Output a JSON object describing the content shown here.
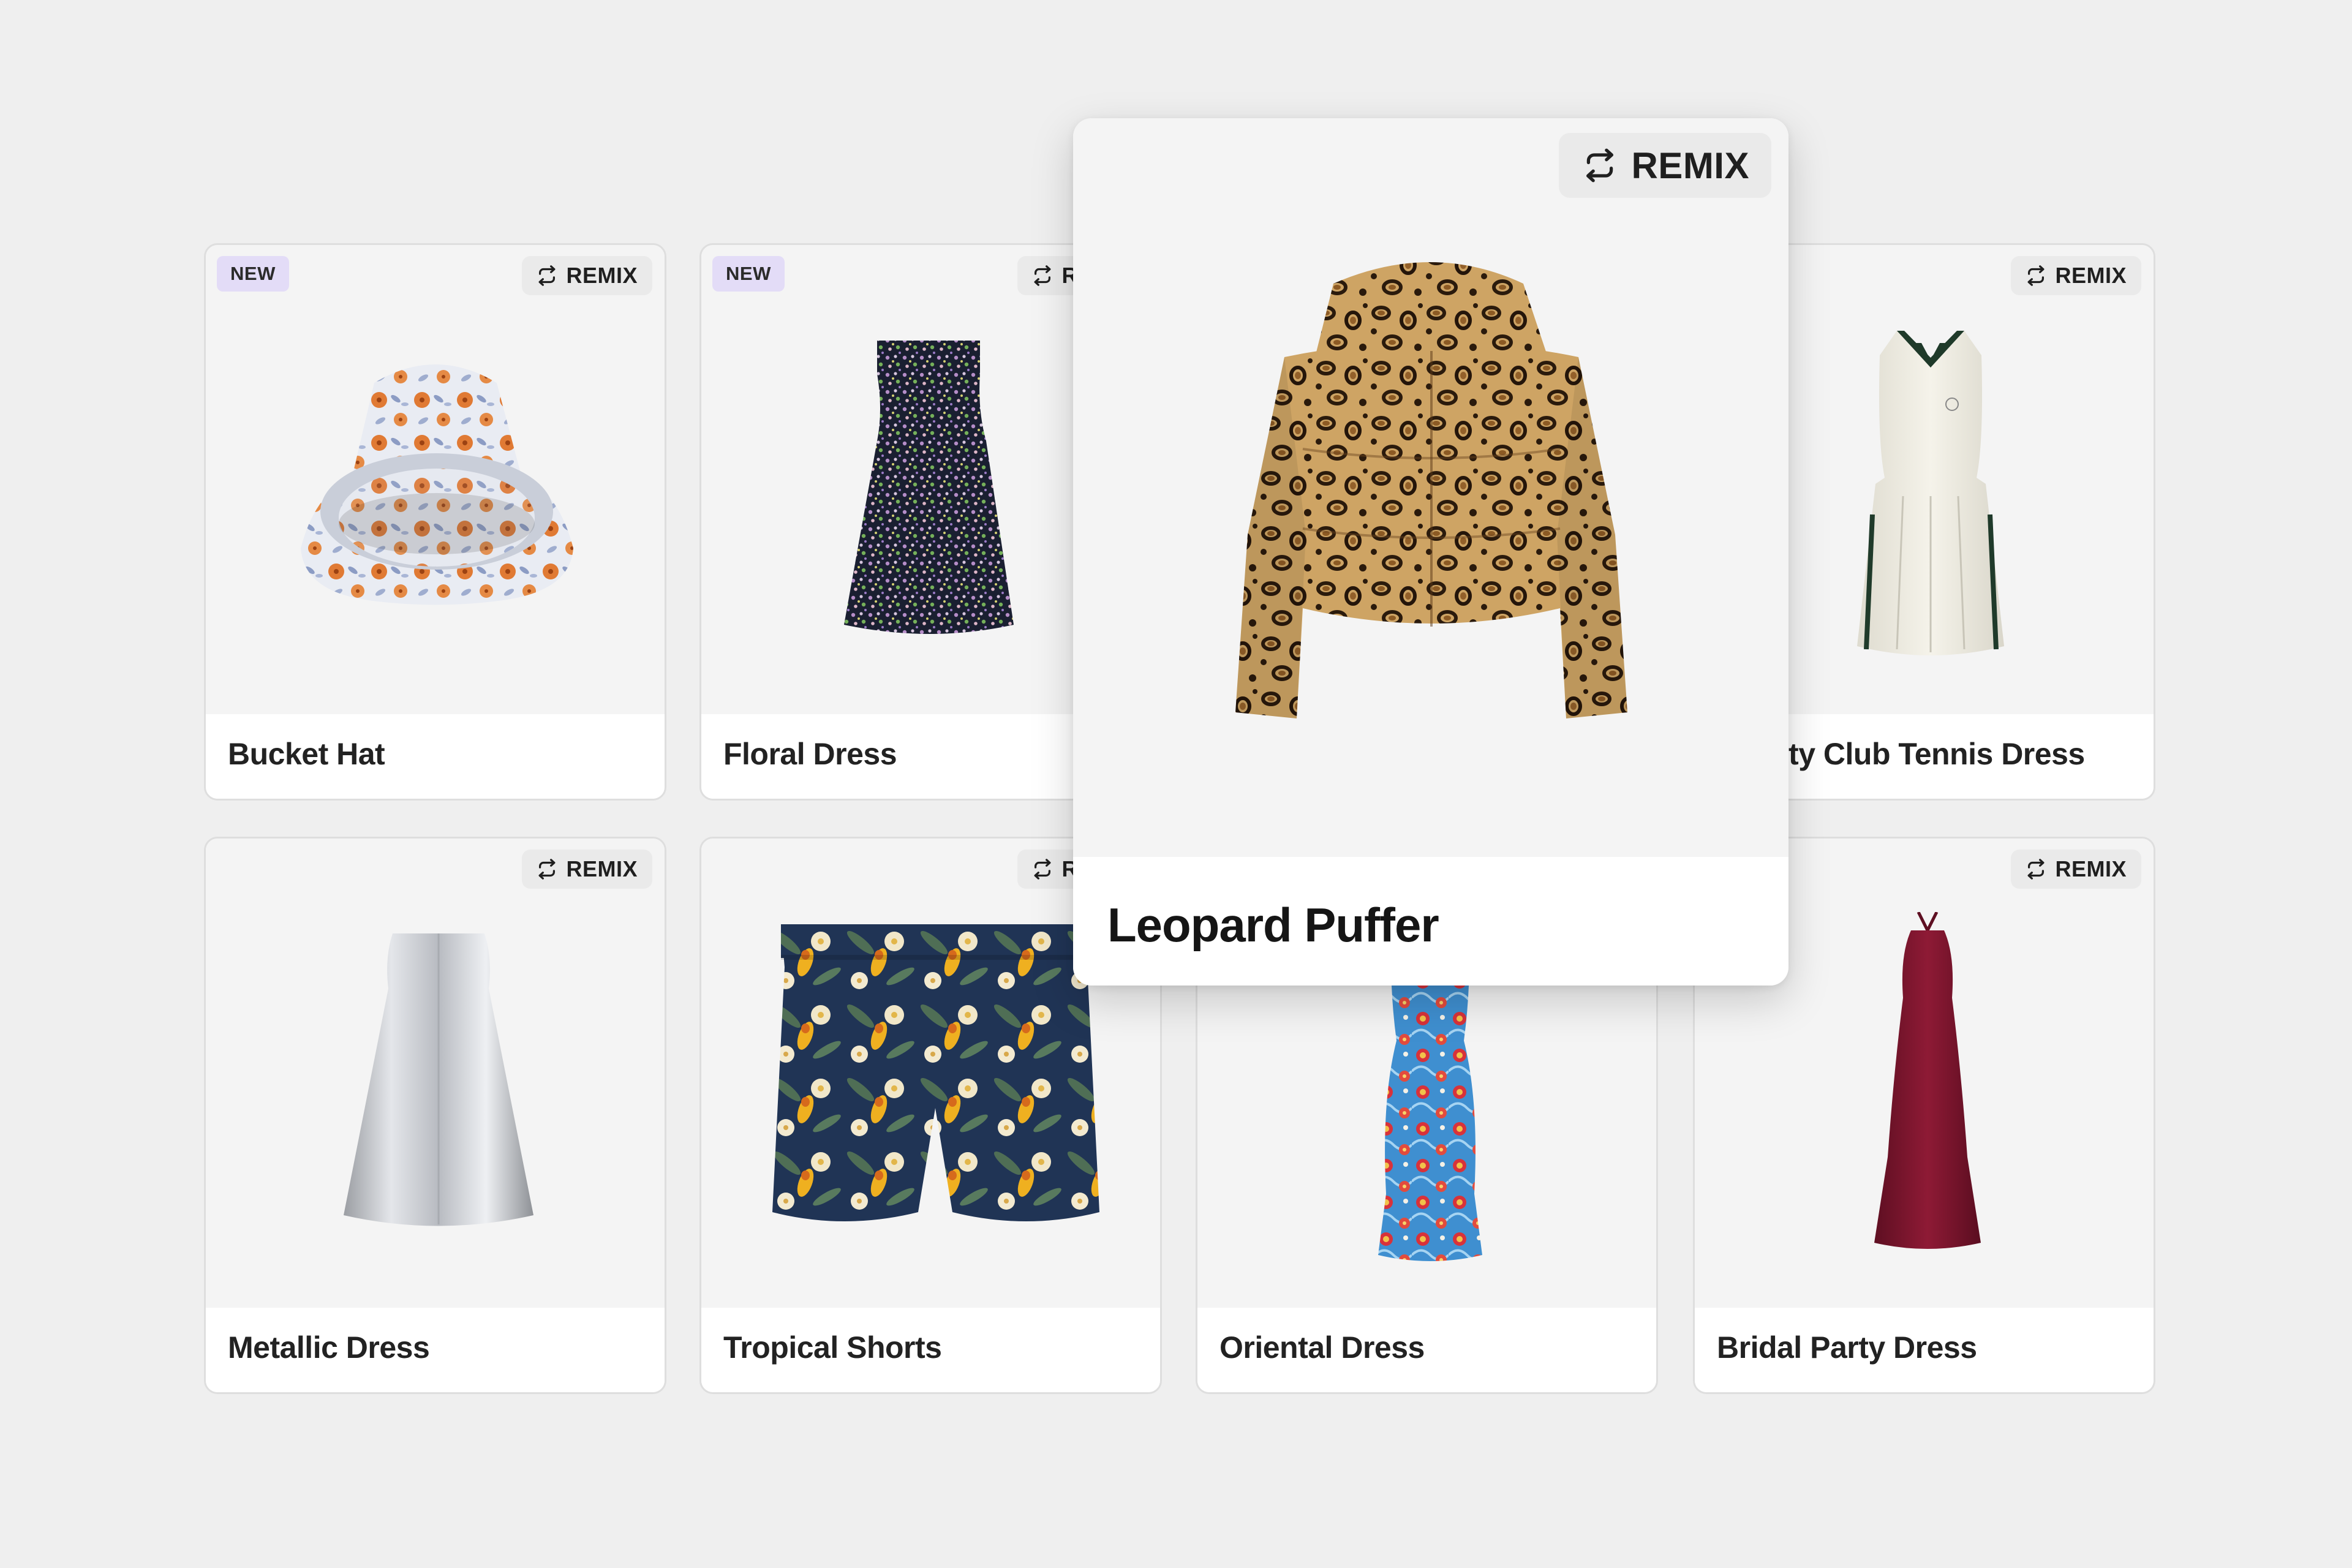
{
  "remix_label": "REMIX",
  "new_label": "NEW",
  "cards": [
    {
      "title": "Bucket Hat",
      "new": true
    },
    {
      "title": "Floral Dress",
      "new": true
    },
    {
      "title": "Varsity Club Tennis Dress",
      "new": false
    },
    {
      "title": "Metallic Dress",
      "new": false
    },
    {
      "title": "Tropical Shorts",
      "new": false
    },
    {
      "title": "Oriental Dress",
      "new": false
    },
    {
      "title": "Bridal Party Dress",
      "new": false
    }
  ],
  "featured": {
    "title": "Leopard Puffer"
  },
  "colors": {
    "background": "#efefef",
    "card": "#f5f5f5",
    "new_badge": "#e3dcf7",
    "remix_button": "#eaeaea"
  }
}
